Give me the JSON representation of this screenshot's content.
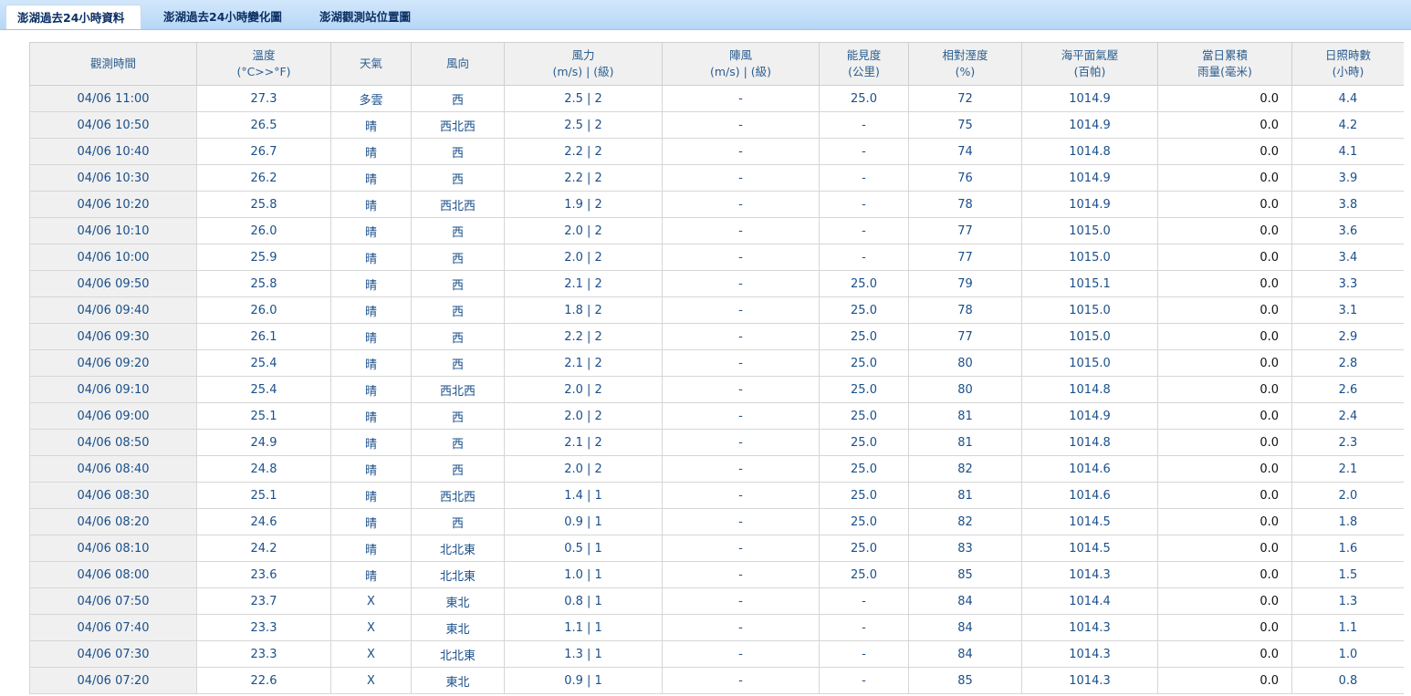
{
  "tabs": [
    {
      "label": "澎湖過去24小時資料",
      "active": true
    },
    {
      "label": "澎湖過去24小時變化圖",
      "active": false
    },
    {
      "label": "澎湖觀測站位置圖",
      "active": false
    }
  ],
  "headers": [
    {
      "line1": "觀測時間",
      "line2": ""
    },
    {
      "line1": "溫度",
      "line2": "(°C>>°F)"
    },
    {
      "line1": "天氣",
      "line2": ""
    },
    {
      "line1": "風向",
      "line2": ""
    },
    {
      "line1": "風力",
      "line2": "(m/s) | (級)"
    },
    {
      "line1": "陣風",
      "line2": "(m/s) | (級)"
    },
    {
      "line1": "能見度",
      "line2": "(公里)"
    },
    {
      "line1": "相對溼度",
      "line2": "(%)"
    },
    {
      "line1": "海平面氣壓",
      "line2": "(百帕)"
    },
    {
      "line1": "當日累積",
      "line2": "雨量(毫米)"
    },
    {
      "line1": "日照時數",
      "line2": "(小時)"
    }
  ],
  "rows": [
    [
      "04/06 11:00",
      "27.3",
      "多雲",
      "西",
      "2.5 | 2",
      "-",
      "25.0",
      "72",
      "1014.9",
      "0.0",
      "4.4"
    ],
    [
      "04/06 10:50",
      "26.5",
      "晴",
      "西北西",
      "2.5 | 2",
      "-",
      "-",
      "75",
      "1014.9",
      "0.0",
      "4.2"
    ],
    [
      "04/06 10:40",
      "26.7",
      "晴",
      "西",
      "2.2 | 2",
      "-",
      "-",
      "74",
      "1014.8",
      "0.0",
      "4.1"
    ],
    [
      "04/06 10:30",
      "26.2",
      "晴",
      "西",
      "2.2 | 2",
      "-",
      "-",
      "76",
      "1014.9",
      "0.0",
      "3.9"
    ],
    [
      "04/06 10:20",
      "25.8",
      "晴",
      "西北西",
      "1.9 | 2",
      "-",
      "-",
      "78",
      "1014.9",
      "0.0",
      "3.8"
    ],
    [
      "04/06 10:10",
      "26.0",
      "晴",
      "西",
      "2.0 | 2",
      "-",
      "-",
      "77",
      "1015.0",
      "0.0",
      "3.6"
    ],
    [
      "04/06 10:00",
      "25.9",
      "晴",
      "西",
      "2.0 | 2",
      "-",
      "-",
      "77",
      "1015.0",
      "0.0",
      "3.4"
    ],
    [
      "04/06 09:50",
      "25.8",
      "晴",
      "西",
      "2.1 | 2",
      "-",
      "25.0",
      "79",
      "1015.1",
      "0.0",
      "3.3"
    ],
    [
      "04/06 09:40",
      "26.0",
      "晴",
      "西",
      "1.8 | 2",
      "-",
      "25.0",
      "78",
      "1015.0",
      "0.0",
      "3.1"
    ],
    [
      "04/06 09:30",
      "26.1",
      "晴",
      "西",
      "2.2 | 2",
      "-",
      "25.0",
      "77",
      "1015.0",
      "0.0",
      "2.9"
    ],
    [
      "04/06 09:20",
      "25.4",
      "晴",
      "西",
      "2.1 | 2",
      "-",
      "25.0",
      "80",
      "1015.0",
      "0.0",
      "2.8"
    ],
    [
      "04/06 09:10",
      "25.4",
      "晴",
      "西北西",
      "2.0 | 2",
      "-",
      "25.0",
      "80",
      "1014.8",
      "0.0",
      "2.6"
    ],
    [
      "04/06 09:00",
      "25.1",
      "晴",
      "西",
      "2.0 | 2",
      "-",
      "25.0",
      "81",
      "1014.9",
      "0.0",
      "2.4"
    ],
    [
      "04/06 08:50",
      "24.9",
      "晴",
      "西",
      "2.1 | 2",
      "-",
      "25.0",
      "81",
      "1014.8",
      "0.0",
      "2.3"
    ],
    [
      "04/06 08:40",
      "24.8",
      "晴",
      "西",
      "2.0 | 2",
      "-",
      "25.0",
      "82",
      "1014.6",
      "0.0",
      "2.1"
    ],
    [
      "04/06 08:30",
      "25.1",
      "晴",
      "西北西",
      "1.4 | 1",
      "-",
      "25.0",
      "81",
      "1014.6",
      "0.0",
      "2.0"
    ],
    [
      "04/06 08:20",
      "24.6",
      "晴",
      "西",
      "0.9 | 1",
      "-",
      "25.0",
      "82",
      "1014.5",
      "0.0",
      "1.8"
    ],
    [
      "04/06 08:10",
      "24.2",
      "晴",
      "北北東",
      "0.5 | 1",
      "-",
      "25.0",
      "83",
      "1014.5",
      "0.0",
      "1.6"
    ],
    [
      "04/06 08:00",
      "23.6",
      "晴",
      "北北東",
      "1.0 | 1",
      "-",
      "25.0",
      "85",
      "1014.3",
      "0.0",
      "1.5"
    ],
    [
      "04/06 07:50",
      "23.7",
      "X",
      "東北",
      "0.8 | 1",
      "-",
      "-",
      "84",
      "1014.4",
      "0.0",
      "1.3"
    ],
    [
      "04/06 07:40",
      "23.3",
      "X",
      "東北",
      "1.1 | 1",
      "-",
      "-",
      "84",
      "1014.3",
      "0.0",
      "1.1"
    ],
    [
      "04/06 07:30",
      "23.3",
      "X",
      "北北東",
      "1.3 | 1",
      "-",
      "-",
      "84",
      "1014.3",
      "0.0",
      "1.0"
    ],
    [
      "04/06 07:20",
      "22.6",
      "X",
      "東北",
      "0.9 | 1",
      "-",
      "-",
      "85",
      "1014.3",
      "0.0",
      "0.8"
    ]
  ]
}
